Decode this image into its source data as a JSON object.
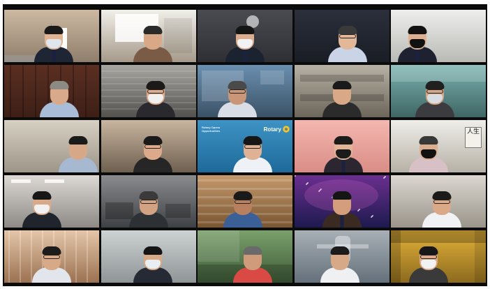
{
  "meeting": {
    "participants": [
      {
        "id": "p01",
        "scene": "podium-flag",
        "bg": [
          "#cdb9a2",
          "#8f7e6c"
        ],
        "shirt": "#1e2535",
        "skin": "#e0b493",
        "hair": "#1a1a1a",
        "mask": "#dfe6ee",
        "glasses": false,
        "tie": true,
        "person_x": "52%"
      },
      {
        "id": "p02",
        "scene": "window",
        "bg": [
          "#f0efe9",
          "#a69a8a"
        ],
        "shirt": "#7a5b46",
        "skin": "#d9a987",
        "hair": "#2a2a2a",
        "mask": "",
        "glasses": false,
        "tie": false,
        "person_x": "55%"
      },
      {
        "id": "p03",
        "scene": "office-lamp",
        "bg": [
          "#4a4b50",
          "#2e2f34"
        ],
        "shirt": "#1b2230",
        "skin": "#dcae8e",
        "hair": "#151515",
        "mask": "#f2f2f2",
        "glasses": false,
        "tie": true,
        "person_x": "50%"
      },
      {
        "id": "p04",
        "scene": "dark-room",
        "bg": [
          "#2a2f3b",
          "#1a1d25"
        ],
        "shirt": "#c9d5e6",
        "skin": "#e2b899",
        "hair": "#3a3a3a",
        "mask": "",
        "glasses": true,
        "tie": false,
        "person_x": "56%"
      },
      {
        "id": "p05",
        "scene": "white-wall",
        "bg": [
          "#eeeeec",
          "#b9b9b6"
        ],
        "shirt": "#1d2130",
        "skin": "#dfb08f",
        "hair": "#121212",
        "mask": "#111111",
        "glasses": false,
        "tie": true,
        "person_x": "28%"
      },
      {
        "id": "p06",
        "scene": "wood-panel",
        "bg": [
          "#5b2f22",
          "#3d1f16"
        ],
        "shirt": "#a9bcd8",
        "skin": "#d8a98a",
        "hair": "#8d8a84",
        "mask": "",
        "glasses": false,
        "tie": false,
        "person_x": "58%"
      },
      {
        "id": "p07",
        "scene": "blinds",
        "bg": [
          "#a8a6a0",
          "#54524f"
        ],
        "shirt": "#2a2a2e",
        "skin": "#dcac8c",
        "hair": "#1a1a1a",
        "mask": "#f0f0f0",
        "glasses": true,
        "tie": false,
        "person_x": "58%"
      },
      {
        "id": "p08",
        "scene": "map-wall",
        "bg": [
          "#6a8fb0",
          "#3b5266"
        ],
        "shirt": "#d9dde5",
        "skin": "#c99777",
        "hair": "#4a4a4a",
        "mask": "",
        "glasses": true,
        "tie": false,
        "person_x": "42%"
      },
      {
        "id": "p09",
        "scene": "shelf",
        "bg": [
          "#b8b2a6",
          "#6d665b"
        ],
        "shirt": "#2b2b2b",
        "skin": "#d9a887",
        "hair": "#1a1a1a",
        "mask": "",
        "glasses": false,
        "tie": false,
        "person_x": "50%"
      },
      {
        "id": "p10",
        "scene": "teal-wall",
        "bg": [
          "#7bb3b0",
          "#3f6664"
        ],
        "shirt": "#3c3c40",
        "skin": "#d7a686",
        "hair": "#202020",
        "mask": "#d8dde3",
        "glasses": true,
        "tie": false,
        "person_x": "46%"
      },
      {
        "id": "p11",
        "scene": "plain-room",
        "bg": [
          "#d7d1c4",
          "#9d9587"
        ],
        "shirt": "#a7b9d1",
        "skin": "#d7a887",
        "hair": "#1a1a1a",
        "mask": "",
        "glasses": false,
        "tie": false,
        "person_x": "78%"
      },
      {
        "id": "p12",
        "scene": "office-desk",
        "bg": [
          "#c9b6a0",
          "#6e5f4f"
        ],
        "shirt": "#262626",
        "skin": "#dca98a",
        "hair": "#1a1a1a",
        "mask": "",
        "glasses": true,
        "tie": false,
        "person_x": "55%"
      },
      {
        "id": "p13",
        "scene": "rotary-background",
        "bg": [
          "#3d93c4",
          "#1e6a9a"
        ],
        "shirt": "#eef1f5",
        "skin": "#e0b295",
        "hair": "#161616",
        "mask": "",
        "glasses": true,
        "tie": false,
        "person_x": "58%"
      },
      {
        "id": "p14",
        "scene": "pink-wall",
        "bg": [
          "#f4b7b0",
          "#d98d86"
        ],
        "shirt": "#2b2630",
        "skin": "#e3b597",
        "hair": "#1c1c1c",
        "mask": "#1b1b1b",
        "glasses": false,
        "tie": true,
        "person_x": "52%"
      },
      {
        "id": "p15",
        "scene": "calligraphy",
        "bg": [
          "#efeee9",
          "#b6b1a6"
        ],
        "shirt": "#d7c1c6",
        "skin": "#dcad8e",
        "hair": "#383838",
        "mask": "#111111",
        "glasses": false,
        "tie": false,
        "person_x": "40%"
      },
      {
        "id": "p16",
        "scene": "office-ceiling",
        "bg": [
          "#dddad5",
          "#8d8a85"
        ],
        "shirt": "#20242c",
        "skin": "#d9aa8a",
        "hair": "#171717",
        "mask": "#f1f1f1",
        "glasses": false,
        "tie": false,
        "person_x": "40%"
      },
      {
        "id": "p17",
        "scene": "office-chairs",
        "bg": [
          "#8a8c8e",
          "#3e4144"
        ],
        "shirt": "#2d3034",
        "skin": "#d3a283",
        "hair": "#3a3a3a",
        "mask": "",
        "glasses": true,
        "tie": false,
        "person_x": "50%"
      },
      {
        "id": "p18",
        "scene": "wood-beams",
        "bg": [
          "#c49a6b",
          "#7a5532"
        ],
        "shirt": "#3b5f97",
        "skin": "#b98060",
        "hair": "#1a1a1a",
        "mask": "",
        "glasses": true,
        "tie": false,
        "person_x": "48%"
      },
      {
        "id": "p19",
        "scene": "space-galaxy",
        "bg": [
          "#6a2f8f",
          "#1d1a4e"
        ],
        "shirt": "#3a2a22",
        "skin": "#d49e7c",
        "hair": "#151515",
        "mask": "",
        "glasses": false,
        "tie": true,
        "person_x": "50%"
      },
      {
        "id": "p20",
        "scene": "interior",
        "bg": [
          "#dbd7d0",
          "#9a948a"
        ],
        "shirt": "#f1f2f4",
        "skin": "#d9a988",
        "hair": "#1a1a1a",
        "mask": "",
        "glasses": true,
        "tie": false,
        "person_x": "54%"
      },
      {
        "id": "p21",
        "scene": "shoji",
        "bg": [
          "#e6c6a9",
          "#9b7151"
        ],
        "shirt": "#e2e6ec",
        "skin": "#d8a986",
        "hair": "#1c1c1c",
        "mask": "",
        "glasses": true,
        "tie": false,
        "person_x": "50%"
      },
      {
        "id": "p22",
        "scene": "grey-wall",
        "bg": [
          "#cdd2d3",
          "#8f9596"
        ],
        "shirt": "#252a34",
        "skin": "#d8a987",
        "hair": "#151515",
        "mask": "#e9eef3",
        "glasses": false,
        "tie": false,
        "person_x": "55%"
      },
      {
        "id": "p23",
        "scene": "garden",
        "bg": [
          "#7aa06b",
          "#3e5b38"
        ],
        "shirt": "#d84a43",
        "skin": "#cf9b7b",
        "hair": "#6a6a6a",
        "mask": "",
        "glasses": false,
        "tie": false,
        "person_x": "58%"
      },
      {
        "id": "p24",
        "scene": "christ-statue",
        "bg": [
          "#a8b0b6",
          "#64707a"
        ],
        "shirt": "#eef0f2",
        "skin": "#d8a987",
        "hair": "#1b1b1b",
        "mask": "",
        "glasses": false,
        "tie": false,
        "person_x": "48%"
      },
      {
        "id": "p25",
        "scene": "car",
        "bg": [
          "#e5b33a",
          "#8c6a1e"
        ],
        "shirt": "#3a3a3a",
        "skin": "#dcab8b",
        "hair": "#171717",
        "mask": "#f2f2f2",
        "glasses": true,
        "tie": false,
        "person_x": "40%"
      }
    ],
    "rotary_tagline": "Rotary Opens\nOpportunities",
    "rotary_wordmark": "Rotary",
    "sign_text": "人生"
  }
}
